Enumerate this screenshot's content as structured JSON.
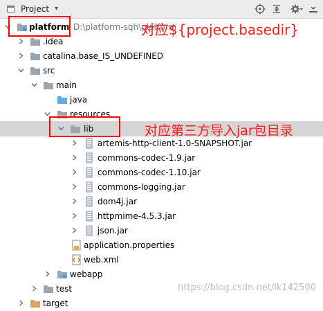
{
  "header": {
    "title": "Project",
    "icons": [
      "panel-icon",
      "target-icon",
      "collapse-icon",
      "settings-icon",
      "hide-icon"
    ]
  },
  "tree": {
    "root": {
      "label": "platform",
      "path": "D:\\platform-sqh\\platform"
    },
    "items": [
      {
        "label": ".idea",
        "icon": "folder"
      },
      {
        "label": "catalina.base_IS_UNDEFINED",
        "icon": "folder"
      },
      {
        "label": "src",
        "icon": "folder"
      },
      {
        "label": "main",
        "icon": "folder"
      },
      {
        "label": "java",
        "icon": "source-folder"
      },
      {
        "label": "resources",
        "icon": "resource-folder"
      },
      {
        "label": "lib",
        "icon": "folder"
      },
      {
        "label": "artemis-http-client-1.0-SNAPSHOT.jar",
        "icon": "jar"
      },
      {
        "label": "commons-codec-1.9.jar",
        "icon": "jar"
      },
      {
        "label": "commons-codec-1.10.jar",
        "icon": "jar"
      },
      {
        "label": "commons-logging.jar",
        "icon": "jar"
      },
      {
        "label": "dom4j.jar",
        "icon": "jar"
      },
      {
        "label": "httpmime-4.5.3.jar",
        "icon": "jar"
      },
      {
        "label": "json.jar",
        "icon": "jar"
      },
      {
        "label": "application.properties",
        "icon": "properties"
      },
      {
        "label": "web.xml",
        "icon": "xml"
      },
      {
        "label": "webapp",
        "icon": "web-folder"
      },
      {
        "label": "test",
        "icon": "folder"
      },
      {
        "label": "target",
        "icon": "folder-orange"
      }
    ]
  },
  "annotations": {
    "basedir": "对应${project.basedir}",
    "lib": "对应第三方导入jar包目录"
  },
  "watermark": "https://blog.csdn.net/lk142500",
  "colors": {
    "annotation": "#ff0000",
    "selection": "#d5d5d5",
    "folder": "#9aa7b0",
    "source_folder": "#5bb0e8",
    "jar": "#7c8fa6"
  }
}
